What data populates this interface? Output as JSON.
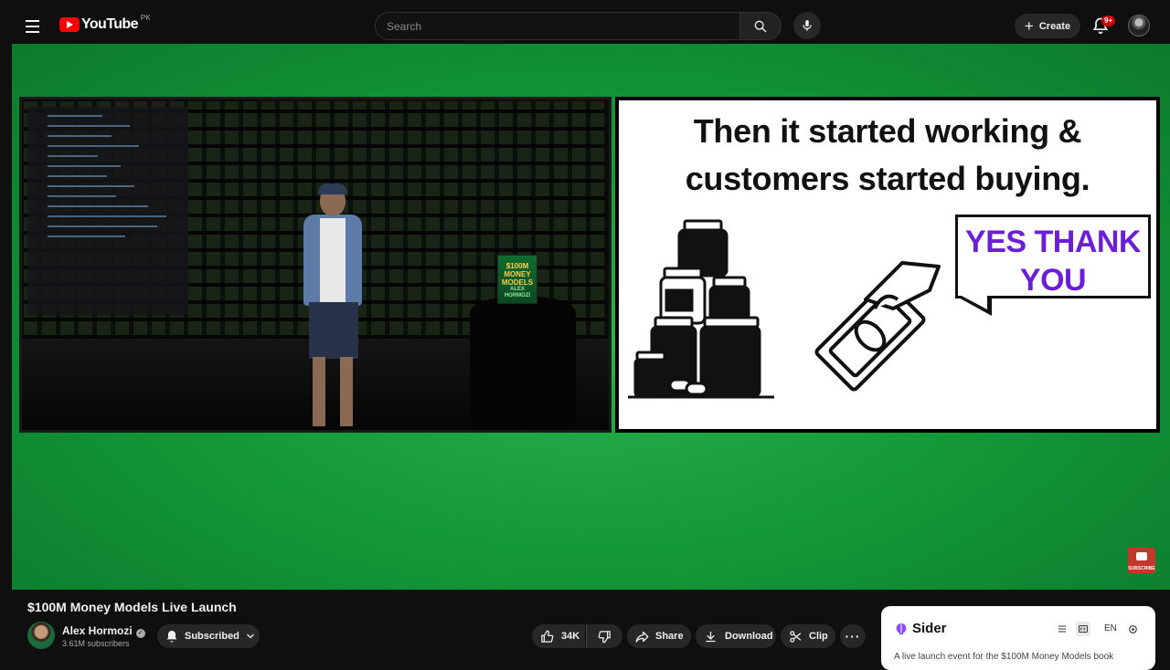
{
  "header": {
    "logo_text": "YouTube",
    "region": "PK",
    "search_placeholder": "Search",
    "create_label": "Create",
    "notification_count": "9+"
  },
  "slide": {
    "title_line1": "Then it started working &",
    "title_line2": "customers started buying.",
    "speech_line1": "YES THANK",
    "speech_line2": "YOU"
  },
  "stage": {
    "book_title": "$100M MONEY MODELS",
    "book_author": "ALEX HORMOZI"
  },
  "watermark": {
    "label": "SUBSCRIBE"
  },
  "video": {
    "title": "$100M Money Models Live Launch",
    "channel_name": "Alex Hormozi",
    "subscribers": "3.61M subscribers",
    "subscribed_label": "Subscribed",
    "likes": "34K",
    "share_label": "Share",
    "download_label": "Download",
    "clip_label": "Clip"
  },
  "sider": {
    "name": "Sider",
    "lang": "EN",
    "description": "A live launch event for the $100M Money Models book"
  },
  "colors": {
    "accent": "#ff0000",
    "green_screen": "#149b3a",
    "speech_text": "#6a1fd6"
  }
}
